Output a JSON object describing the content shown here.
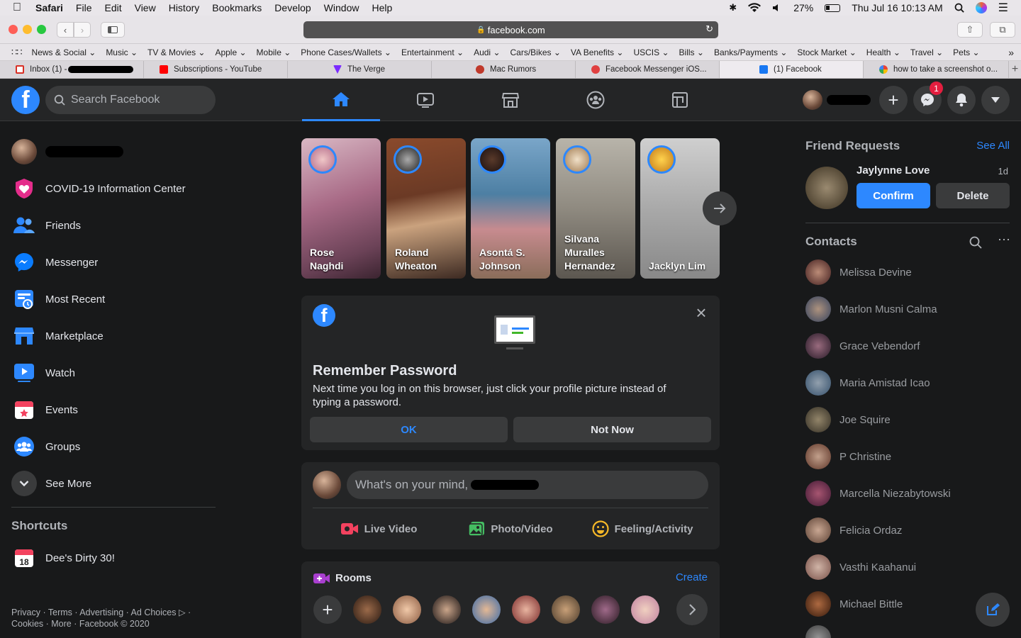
{
  "menubar": {
    "app": "Safari",
    "items": [
      "File",
      "Edit",
      "View",
      "History",
      "Bookmarks",
      "Develop",
      "Window",
      "Help"
    ],
    "battery": "27%",
    "datetime": "Thu Jul 16  10:13 AM"
  },
  "browser": {
    "url": "facebook.com",
    "bookmarks": [
      "News & Social",
      "Music",
      "TV & Movies",
      "Apple",
      "Mobile",
      "Phone Cases/Wallets",
      "Entertainment",
      "Audi",
      "Cars/Bikes",
      "VA Benefits",
      "USCIS",
      "Bills",
      "Banks/Payments",
      "Stock Market",
      "Health",
      "Travel",
      "Pets"
    ],
    "tabs": [
      {
        "label": "Inbox (1) -",
        "color": "#d93025"
      },
      {
        "label": "Subscriptions - YouTube",
        "color": "#ff0000"
      },
      {
        "label": "The Verge",
        "color": "#7b2cff"
      },
      {
        "label": "Mac Rumors",
        "color": "#c0392b"
      },
      {
        "label": "Facebook Messenger iOS...",
        "color": "#e04040"
      },
      {
        "label": "(1) Facebook",
        "color": "#1877f2"
      },
      {
        "label": "how to take a screenshot o...",
        "color": "#4285f4"
      }
    ]
  },
  "header": {
    "search_placeholder": "Search Facebook",
    "messenger_badge": "1"
  },
  "left": {
    "covid": "COVID-19 Information Center",
    "friends": "Friends",
    "messenger": "Messenger",
    "most_recent": "Most Recent",
    "marketplace": "Marketplace",
    "watch": "Watch",
    "events": "Events",
    "groups": "Groups",
    "see_more": "See More",
    "shortcuts_title": "Shortcuts",
    "shortcut_1": "Dee's Dirty 30!",
    "footer_line1": "Privacy · Terms · Advertising · Ad Choices ▷ ·",
    "footer_line2": "Cookies · More · Facebook © 2020"
  },
  "stories": [
    {
      "name": "Rose\nNaghdi"
    },
    {
      "name": "Roland\nWheaton"
    },
    {
      "name": "Asontá S.\nJohnson"
    },
    {
      "name": "Silvana\nMuralles\nHernandez"
    },
    {
      "name": "Jacklyn Lim"
    }
  ],
  "remember": {
    "title": "Remember Password",
    "body": "Next time you log in on this browser, just click your profile picture instead of typing a password.",
    "ok": "OK",
    "not_now": "Not Now"
  },
  "composer": {
    "placeholder": "What's on your mind,",
    "live": "Live Video",
    "photo": "Photo/Video",
    "feeling": "Feeling/Activity"
  },
  "rooms": {
    "title": "Rooms",
    "create": "Create"
  },
  "right": {
    "fr_title": "Friend Requests",
    "see_all": "See All",
    "fr_name": "Jaylynne Love",
    "fr_time": "1d",
    "confirm": "Confirm",
    "delete": "Delete",
    "contacts_title": "Contacts",
    "contacts": [
      "Melissa Devine",
      "Marlon Musni Calma",
      "Grace Vebendorf",
      "Maria Amistad Icao",
      "Joe Squire",
      "P Christine",
      "Marcella Niezabytowski",
      "Felicia Ordaz",
      "Vasthi Kaahanui",
      "Michael Bittle"
    ]
  }
}
